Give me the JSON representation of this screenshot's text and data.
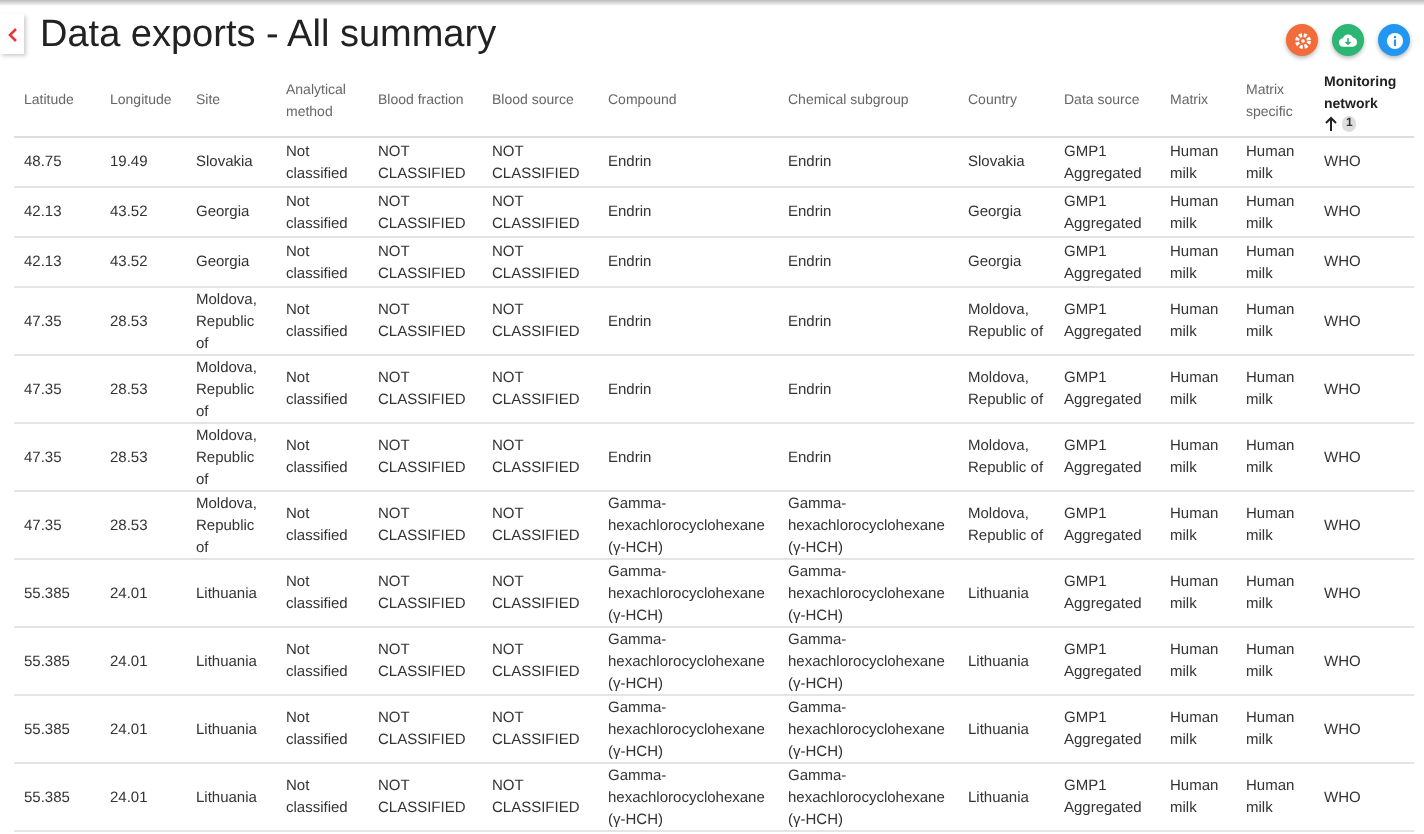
{
  "page": {
    "title": "Data exports - All summary"
  },
  "actions": [
    {
      "kind": "settings",
      "color": "#f26b3a"
    },
    {
      "kind": "download",
      "color": "#2bb673"
    },
    {
      "kind": "info",
      "color": "#2196f3"
    }
  ],
  "table": {
    "columns": [
      {
        "label": "Latitude",
        "sorted": false
      },
      {
        "label": "Longitude",
        "sorted": false
      },
      {
        "label": "Site",
        "sorted": false
      },
      {
        "label": "Analytical method",
        "sorted": false
      },
      {
        "label": "Blood fraction",
        "sorted": false
      },
      {
        "label": "Blood source",
        "sorted": false
      },
      {
        "label": "Compound",
        "sorted": false
      },
      {
        "label": "Chemical subgroup",
        "sorted": false
      },
      {
        "label": "Country",
        "sorted": false
      },
      {
        "label": "Data source",
        "sorted": false
      },
      {
        "label": "Matrix",
        "sorted": false
      },
      {
        "label": "Matrix specific",
        "sorted": false
      },
      {
        "label": "Monitoring network",
        "sorted": true,
        "sort_order": "1"
      }
    ],
    "rows": [
      [
        "48.75",
        "19.49",
        "Slovakia",
        "Not classified",
        "NOT CLASSIFIED",
        "NOT CLASSIFIED",
        "Endrin",
        "Endrin",
        "Slovakia",
        "GMP1 Aggregated",
        "Human milk",
        "Human milk",
        "WHO"
      ],
      [
        "42.13",
        "43.52",
        "Georgia",
        "Not classified",
        "NOT CLASSIFIED",
        "NOT CLASSIFIED",
        "Endrin",
        "Endrin",
        "Georgia",
        "GMP1 Aggregated",
        "Human milk",
        "Human milk",
        "WHO"
      ],
      [
        "42.13",
        "43.52",
        "Georgia",
        "Not classified",
        "NOT CLASSIFIED",
        "NOT CLASSIFIED",
        "Endrin",
        "Endrin",
        "Georgia",
        "GMP1 Aggregated",
        "Human milk",
        "Human milk",
        "WHO"
      ],
      [
        "47.35",
        "28.53",
        "Moldova, Republic of",
        "Not classified",
        "NOT CLASSIFIED",
        "NOT CLASSIFIED",
        "Endrin",
        "Endrin",
        "Moldova, Republic of",
        "GMP1 Aggregated",
        "Human milk",
        "Human milk",
        "WHO"
      ],
      [
        "47.35",
        "28.53",
        "Moldova, Republic of",
        "Not classified",
        "NOT CLASSIFIED",
        "NOT CLASSIFIED",
        "Endrin",
        "Endrin",
        "Moldova, Republic of",
        "GMP1 Aggregated",
        "Human milk",
        "Human milk",
        "WHO"
      ],
      [
        "47.35",
        "28.53",
        "Moldova, Republic of",
        "Not classified",
        "NOT CLASSIFIED",
        "NOT CLASSIFIED",
        "Endrin",
        "Endrin",
        "Moldova, Republic of",
        "GMP1 Aggregated",
        "Human milk",
        "Human milk",
        "WHO"
      ],
      [
        "47.35",
        "28.53",
        "Moldova, Republic of",
        "Not classified",
        "NOT CLASSIFIED",
        "NOT CLASSIFIED",
        "Gamma-hexachlorocyclohexane (γ-HCH)",
        "Gamma-hexachlorocyclohexane (γ-HCH)",
        "Moldova, Republic of",
        "GMP1 Aggregated",
        "Human milk",
        "Human milk",
        "WHO"
      ],
      [
        "55.385",
        "24.01",
        "Lithuania",
        "Not classified",
        "NOT CLASSIFIED",
        "NOT CLASSIFIED",
        "Gamma-hexachlorocyclohexane (γ-HCH)",
        "Gamma-hexachlorocyclohexane (γ-HCH)",
        "Lithuania",
        "GMP1 Aggregated",
        "Human milk",
        "Human milk",
        "WHO"
      ],
      [
        "55.385",
        "24.01",
        "Lithuania",
        "Not classified",
        "NOT CLASSIFIED",
        "NOT CLASSIFIED",
        "Gamma-hexachlorocyclohexane (γ-HCH)",
        "Gamma-hexachlorocyclohexane (γ-HCH)",
        "Lithuania",
        "GMP1 Aggregated",
        "Human milk",
        "Human milk",
        "WHO"
      ],
      [
        "55.385",
        "24.01",
        "Lithuania",
        "Not classified",
        "NOT CLASSIFIED",
        "NOT CLASSIFIED",
        "Gamma-hexachlorocyclohexane (γ-HCH)",
        "Gamma-hexachlorocyclohexane (γ-HCH)",
        "Lithuania",
        "GMP1 Aggregated",
        "Human milk",
        "Human milk",
        "WHO"
      ],
      [
        "55.385",
        "24.01",
        "Lithuania",
        "Not classified",
        "NOT CLASSIFIED",
        "NOT CLASSIFIED",
        "Gamma-hexachlorocyclohexane (γ-HCH)",
        "Gamma-hexachlorocyclohexane (γ-HCH)",
        "Lithuania",
        "GMP1 Aggregated",
        "Human milk",
        "Human milk",
        "WHO"
      ]
    ]
  }
}
